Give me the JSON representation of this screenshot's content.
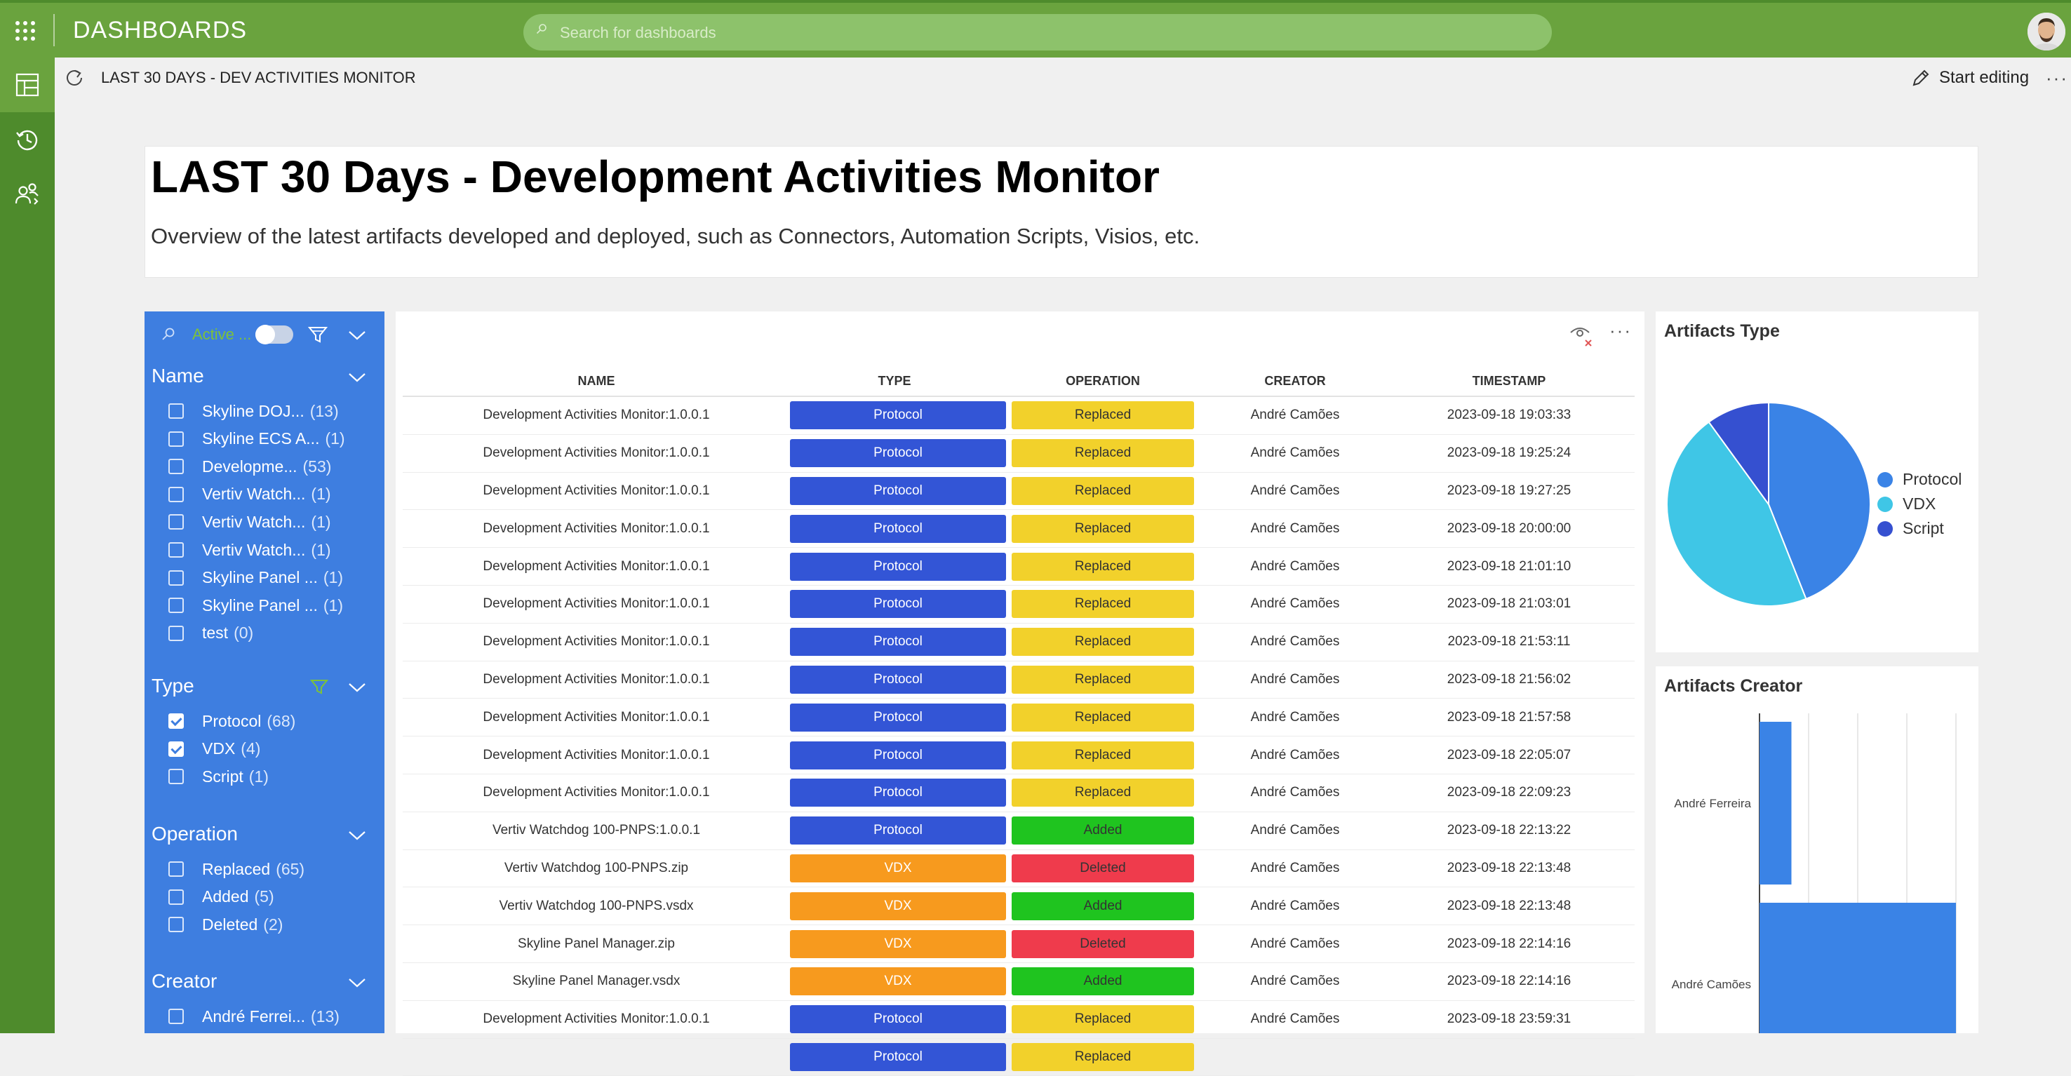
{
  "app": {
    "title": "DASHBOARDS"
  },
  "search": {
    "placeholder": "Search for dashboards"
  },
  "icons": {
    "apps": "apps-grid-icon",
    "search": "search-icon",
    "user": "user-avatar",
    "rail": [
      "dashboard-icon",
      "history-icon",
      "users-icon"
    ],
    "refresh": "refresh-icon",
    "edit": "pencil-icon",
    "more": "more-icon",
    "eye": "eye-icon",
    "filter": "filter-icon",
    "chevron": "chevron-down-icon"
  },
  "subheader": {
    "breadcrumb": "LAST 30 DAYS - DEV ACTIVITIES MONITOR",
    "start_editing": "Start editing",
    "more": "···"
  },
  "header_card": {
    "title": "LAST 30 Days - Development Activities Monitor",
    "subtitle": "Overview of the latest artifacts developed and deployed, such as Connectors, Automation Scripts, Visios, etc."
  },
  "filter_panel": {
    "active_label": "Active ...",
    "sections": [
      {
        "title": "Name",
        "items": [
          {
            "label": "Skyline DOJ...",
            "count": "(13)",
            "checked": false
          },
          {
            "label": "Skyline ECS A...",
            "count": "(1)",
            "checked": false
          },
          {
            "label": "Developme...",
            "count": "(53)",
            "checked": false
          },
          {
            "label": "Vertiv Watch...",
            "count": "(1)",
            "checked": false
          },
          {
            "label": "Vertiv Watch...",
            "count": "(1)",
            "checked": false
          },
          {
            "label": "Vertiv Watch...",
            "count": "(1)",
            "checked": false
          },
          {
            "label": "Skyline Panel ...",
            "count": "(1)",
            "checked": false
          },
          {
            "label": "Skyline Panel ...",
            "count": "(1)",
            "checked": false
          },
          {
            "label": "test",
            "count": "(0)",
            "checked": false
          }
        ]
      },
      {
        "title": "Type",
        "items": [
          {
            "label": "Protocol",
            "count": "(68)",
            "checked": true
          },
          {
            "label": "VDX",
            "count": "(4)",
            "checked": true
          },
          {
            "label": "Script",
            "count": "(1)",
            "checked": false
          }
        ]
      },
      {
        "title": "Operation",
        "items": [
          {
            "label": "Replaced",
            "count": "(65)",
            "checked": false
          },
          {
            "label": "Added",
            "count": "(5)",
            "checked": false
          },
          {
            "label": "Deleted",
            "count": "(2)",
            "checked": false
          }
        ]
      },
      {
        "title": "Creator",
        "items": [
          {
            "label": "André Ferrei...",
            "count": "(13)",
            "checked": false
          }
        ]
      }
    ]
  },
  "table": {
    "columns": [
      "NAME",
      "TYPE",
      "OPERATION",
      "CREATOR",
      "TIMESTAMP"
    ],
    "type_colors": {
      "Protocol": "#3355d6",
      "VDX": "#f79a1e"
    },
    "op_colors": {
      "Replaced": "#f2d12b",
      "Added": "#1fc41f",
      "Deleted": "#ef3b4c"
    },
    "rows": [
      [
        "Development Activities Monitor:1.0.0.1",
        "Protocol",
        "Replaced",
        "André Camões",
        "2023-09-18 19:03:33"
      ],
      [
        "Development Activities Monitor:1.0.0.1",
        "Protocol",
        "Replaced",
        "André Camões",
        "2023-09-18 19:25:24"
      ],
      [
        "Development Activities Monitor:1.0.0.1",
        "Protocol",
        "Replaced",
        "André Camões",
        "2023-09-18 19:27:25"
      ],
      [
        "Development Activities Monitor:1.0.0.1",
        "Protocol",
        "Replaced",
        "André Camões",
        "2023-09-18 20:00:00"
      ],
      [
        "Development Activities Monitor:1.0.0.1",
        "Protocol",
        "Replaced",
        "André Camões",
        "2023-09-18 21:01:10"
      ],
      [
        "Development Activities Monitor:1.0.0.1",
        "Protocol",
        "Replaced",
        "André Camões",
        "2023-09-18 21:03:01"
      ],
      [
        "Development Activities Monitor:1.0.0.1",
        "Protocol",
        "Replaced",
        "André Camões",
        "2023-09-18 21:53:11"
      ],
      [
        "Development Activities Monitor:1.0.0.1",
        "Protocol",
        "Replaced",
        "André Camões",
        "2023-09-18 21:56:02"
      ],
      [
        "Development Activities Monitor:1.0.0.1",
        "Protocol",
        "Replaced",
        "André Camões",
        "2023-09-18 21:57:58"
      ],
      [
        "Development Activities Monitor:1.0.0.1",
        "Protocol",
        "Replaced",
        "André Camões",
        "2023-09-18 22:05:07"
      ],
      [
        "Development Activities Monitor:1.0.0.1",
        "Protocol",
        "Replaced",
        "André Camões",
        "2023-09-18 22:09:23"
      ],
      [
        "Vertiv Watchdog 100-PNPS:1.0.0.1",
        "Protocol",
        "Added",
        "André Camões",
        "2023-09-18 22:13:22"
      ],
      [
        "Vertiv Watchdog 100-PNPS.zip",
        "VDX",
        "Deleted",
        "André Camões",
        "2023-09-18 22:13:48"
      ],
      [
        "Vertiv Watchdog 100-PNPS.vsdx",
        "VDX",
        "Added",
        "André Camões",
        "2023-09-18 22:13:48"
      ],
      [
        "Skyline Panel Manager.zip",
        "VDX",
        "Deleted",
        "André Camões",
        "2023-09-18 22:14:16"
      ],
      [
        "Skyline Panel Manager.vsdx",
        "VDX",
        "Added",
        "André Camões",
        "2023-09-18 22:14:16"
      ],
      [
        "Development Activities Monitor:1.0.0.1",
        "Protocol",
        "Replaced",
        "André Camões",
        "2023-09-18 23:59:31"
      ],
      [
        "",
        "Protocol",
        "Replaced",
        "",
        ""
      ]
    ]
  },
  "chart_data": [
    {
      "type": "pie",
      "title": "Artifacts Type",
      "legend_position": "right",
      "categories": [
        "Protocol",
        "VDX",
        "Script"
      ],
      "values": [
        44,
        46,
        10
      ],
      "colors": [
        "#3a83e6",
        "#3fc6e6",
        "#3550d0"
      ]
    },
    {
      "type": "bar",
      "orientation": "horizontal",
      "title": "Artifacts Creator",
      "categories": [
        "André Ferreira",
        "André Camões"
      ],
      "values": [
        13,
        80
      ],
      "xlim": [
        0,
        80
      ],
      "grid": true,
      "color": "#3a83e6"
    }
  ]
}
